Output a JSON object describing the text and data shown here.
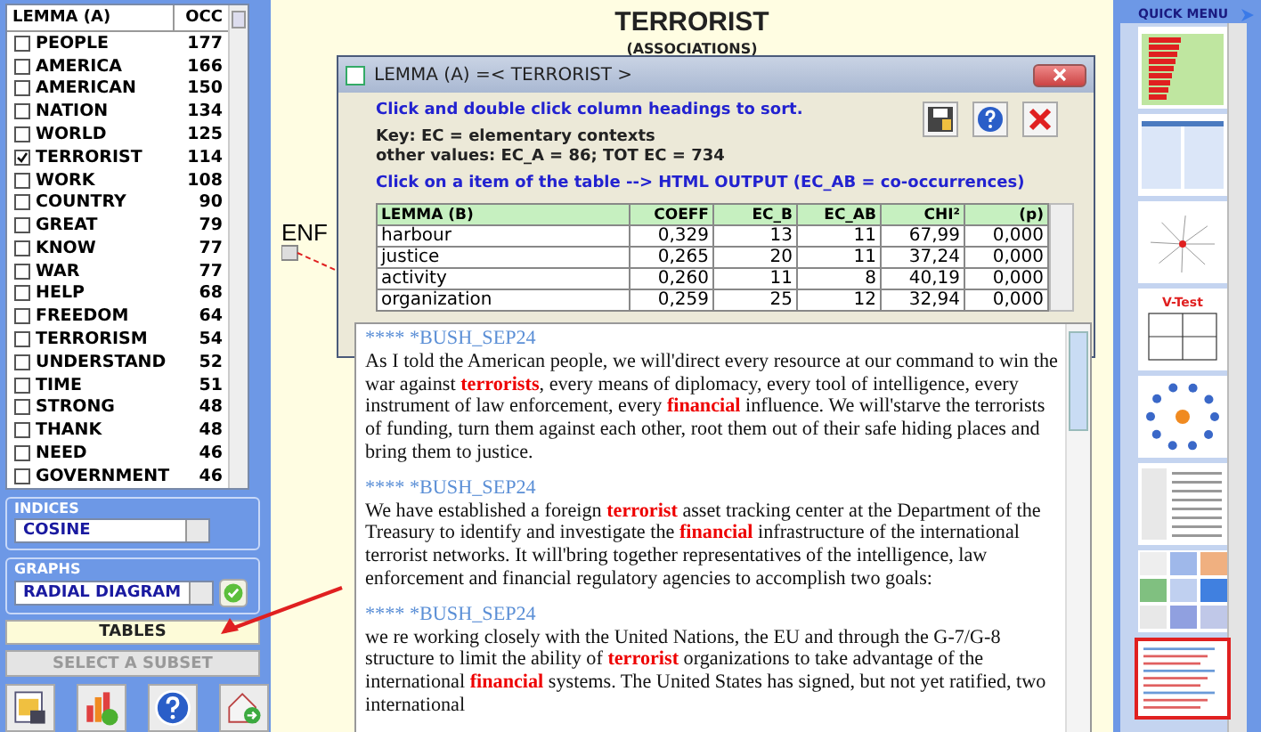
{
  "lemma_list": {
    "columns": [
      "LEMMA (A)",
      "OCC"
    ],
    "rows": [
      {
        "lemma": "PEOPLE",
        "occ": "177",
        "checked": false
      },
      {
        "lemma": "AMERICA",
        "occ": "166",
        "checked": false
      },
      {
        "lemma": "AMERICAN",
        "occ": "150",
        "checked": false
      },
      {
        "lemma": "NATION",
        "occ": "134",
        "checked": false
      },
      {
        "lemma": "WORLD",
        "occ": "125",
        "checked": false
      },
      {
        "lemma": "TERRORIST",
        "occ": "114",
        "checked": true
      },
      {
        "lemma": "WORK",
        "occ": "108",
        "checked": false
      },
      {
        "lemma": "COUNTRY",
        "occ": "90",
        "checked": false
      },
      {
        "lemma": "GREAT",
        "occ": "79",
        "checked": false
      },
      {
        "lemma": "KNOW",
        "occ": "77",
        "checked": false
      },
      {
        "lemma": "WAR",
        "occ": "77",
        "checked": false
      },
      {
        "lemma": "HELP",
        "occ": "68",
        "checked": false
      },
      {
        "lemma": "FREEDOM",
        "occ": "64",
        "checked": false
      },
      {
        "lemma": "TERRORISM",
        "occ": "54",
        "checked": false
      },
      {
        "lemma": "UNDERSTAND",
        "occ": "52",
        "checked": false
      },
      {
        "lemma": "TIME",
        "occ": "51",
        "checked": false
      },
      {
        "lemma": "STRONG",
        "occ": "48",
        "checked": false
      },
      {
        "lemma": "THANK",
        "occ": "48",
        "checked": false
      },
      {
        "lemma": "NEED",
        "occ": "46",
        "checked": false
      },
      {
        "lemma": "GOVERNMENT",
        "occ": "46",
        "checked": false
      }
    ]
  },
  "indices": {
    "label": "INDICES",
    "value": "COSINE"
  },
  "graphs": {
    "label": "GRAPHS",
    "value": "RADIAL DIAGRAM"
  },
  "buttons": [
    {
      "label": "TABLES",
      "disabled": false
    },
    {
      "label": "SELECT A SUBSET",
      "disabled": true
    }
  ],
  "graph": {
    "title": "TERRORIST",
    "subtitle": "(ASSOCIATIONS)",
    "node_label": "ENF"
  },
  "dialog": {
    "title": "LEMMA (A) =< TERRORIST >",
    "instruction": "Click and double click column headings to sort.",
    "key_lines": [
      "Key: EC = elementary contexts",
      "other values: EC_A = 86; TOT EC = 734"
    ],
    "hint": "Click on a item of the table --> HTML OUTPUT (EC_AB = co-occurrences)",
    "table": {
      "columns": [
        "LEMMA (B)",
        "COEFF",
        "EC_B",
        "EC_AB",
        "CHI²",
        "(p)"
      ],
      "rows": [
        [
          "harbour",
          "0,329",
          "13",
          "11",
          "67,99",
          "0,000"
        ],
        [
          "justice",
          "0,265",
          "20",
          "11",
          "37,24",
          "0,000"
        ],
        [
          "activity",
          "0,260",
          "11",
          "8",
          "40,19",
          "0,000"
        ],
        [
          "organization",
          "0,259",
          "25",
          "12",
          "32,94",
          "0,000"
        ]
      ]
    }
  },
  "context_window": {
    "paragraphs": [
      {
        "header": "**** *BUSH_SEP24",
        "text": "As I told the American people, we will'direct every resource at our command to win the war against **terrorists**, every means of diplomacy, every tool of intelligence, every instrument of law enforcement, every **financial** influence. We will'starve the terrorists of funding, turn them against each other, root them out of their safe hiding places and bring them to justice."
      },
      {
        "header": "**** *BUSH_SEP24",
        "text": "We have established a foreign **terrorist** asset tracking center at the Department of the Treasury to identify and investigate the **financial** infrastructure of the international terrorist networks. It will'bring together representatives of the intelligence, law enforcement and financial regulatory agencies to accomplish two goals:"
      },
      {
        "header": "**** *BUSH_SEP24",
        "text": "we re working closely with the United Nations, the EU and through the G-7/G-8 structure to limit the ability of **terrorist** organizations to take advantage of the international **financial** systems. The United States has signed, but not yet ratified, two international"
      }
    ]
  },
  "quick_menu": {
    "title": "QUICK MENU",
    "thumbnails": [
      {
        "kind": "bars",
        "selected": false
      },
      {
        "kind": "tables",
        "selected": false
      },
      {
        "kind": "network",
        "selected": false
      },
      {
        "kind": "quadrant",
        "label": "V-Test",
        "selected": false
      },
      {
        "kind": "bubbles",
        "selected": false
      },
      {
        "kind": "text",
        "selected": false
      },
      {
        "kind": "grid",
        "selected": false
      },
      {
        "kind": "page",
        "selected": true
      }
    ]
  }
}
